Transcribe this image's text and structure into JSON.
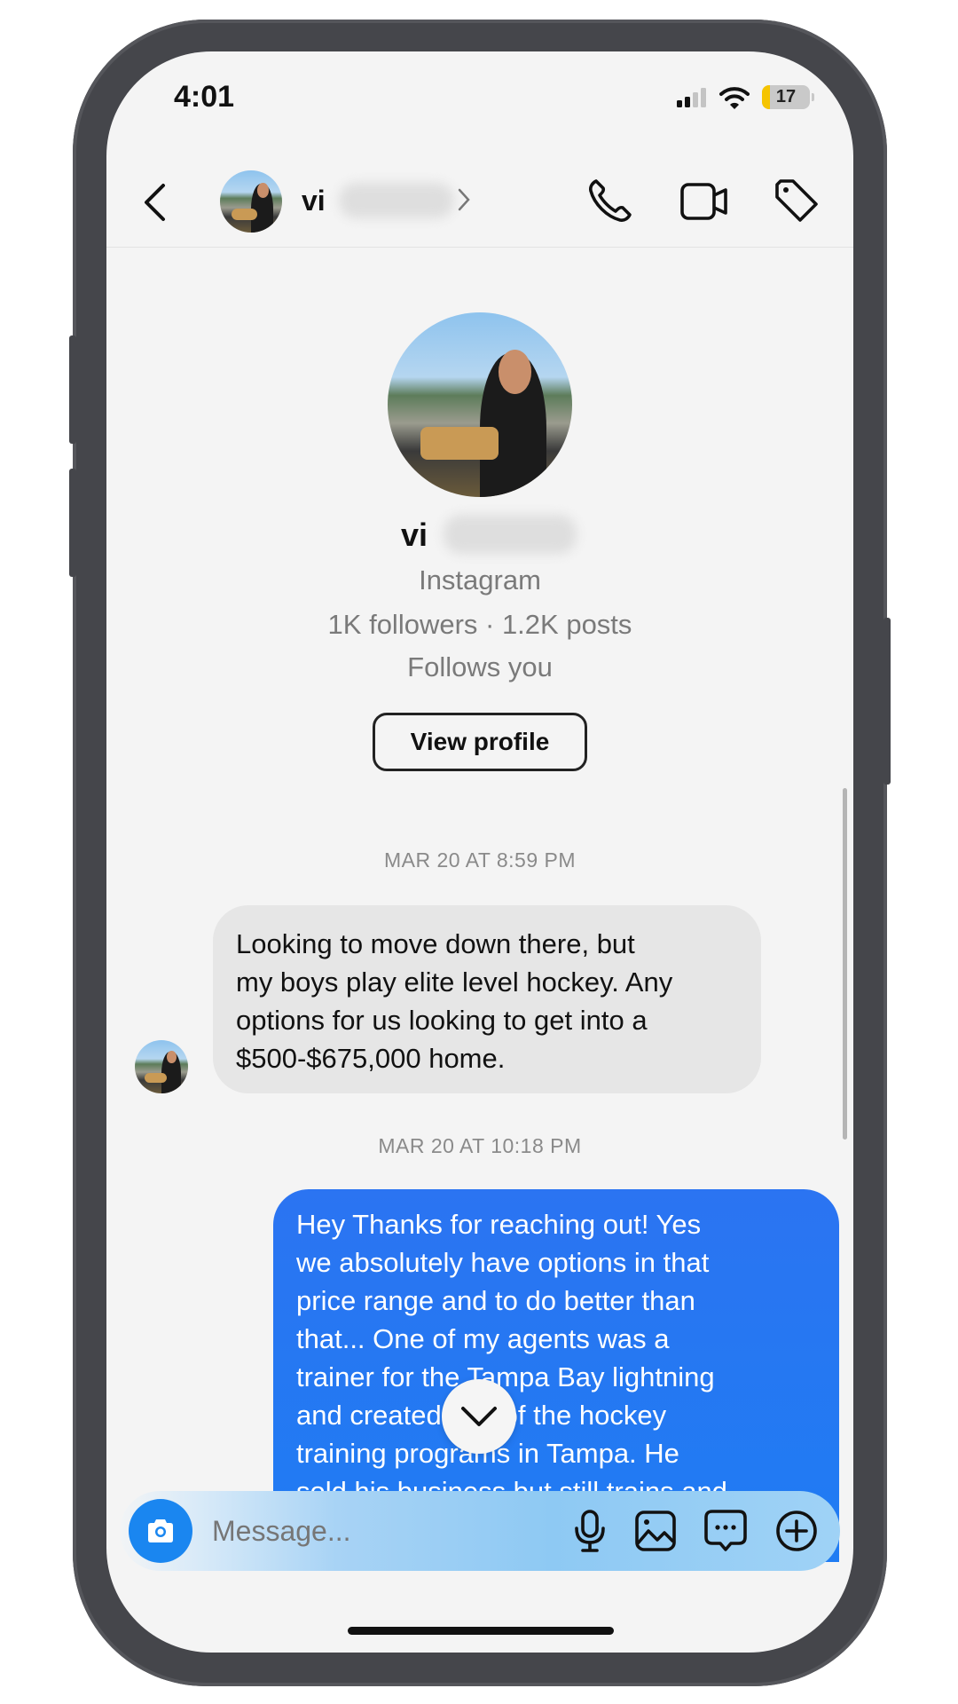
{
  "status_bar": {
    "time": "4:01",
    "battery_level": "17",
    "battery_percent": 17,
    "signal_bars_active": 2,
    "signal_bars_total": 4
  },
  "header": {
    "username_visible": "vi",
    "username_redacted": true,
    "icons": [
      "back-chevron",
      "phone",
      "video-camera",
      "tag"
    ]
  },
  "profile_card": {
    "username_visible": "vi",
    "source": "Instagram",
    "stats": "1K followers · 1.2K posts",
    "follow_status": "Follows you",
    "view_profile_label": "View profile"
  },
  "messages": [
    {
      "timestamp": "MAR 20 AT 8:59 PM",
      "direction": "incoming",
      "lines": [
        "Looking to move down there, but",
        "my boys play elite level hockey. Any",
        "options for us looking to get into a",
        "$500-$675,000 home."
      ]
    },
    {
      "timestamp": "MAR 20 AT 10:18 PM",
      "direction": "outgoing",
      "lines": [
        "Hey Thanks for reaching out!  Yes",
        "we absolutely have options in that",
        "price range and to do better than",
        "that... One of my agents was a",
        "trainer for the Tampa Bay lightning",
        "and created one of the hockey",
        "training programs in Tampa.  He",
        "sold his business but still trains and"
      ]
    }
  ],
  "composer": {
    "placeholder": "Message...",
    "icons": [
      "camera",
      "microphone",
      "gallery",
      "sticker-chat",
      "plus-circle"
    ]
  },
  "colors": {
    "outgoing_bubble": "#2176f2",
    "incoming_bubble": "#e6e6e6",
    "camera_button": "#1a86f0",
    "battery_low": "#f5c400",
    "background": "#f4f4f4"
  }
}
